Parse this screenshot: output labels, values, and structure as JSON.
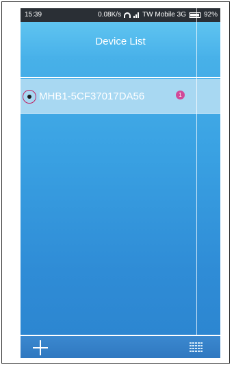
{
  "status_bar": {
    "time": "15:39",
    "speed": "0.08K/s",
    "carrier": "TW Mobile 3G",
    "battery": "92%",
    "battery_level": 0.92
  },
  "header": {
    "title": "Device List"
  },
  "devices": [
    {
      "name": "MHB1-5CF37017DA56",
      "badge": "1"
    }
  ],
  "colors": {
    "accent": "#3aa2e3",
    "selected_row": "#a8d8f2",
    "badge": "#d14a99",
    "status_ring": "#c02060"
  },
  "icons": {
    "add": "plus-icon",
    "menu": "list-menu-icon"
  }
}
